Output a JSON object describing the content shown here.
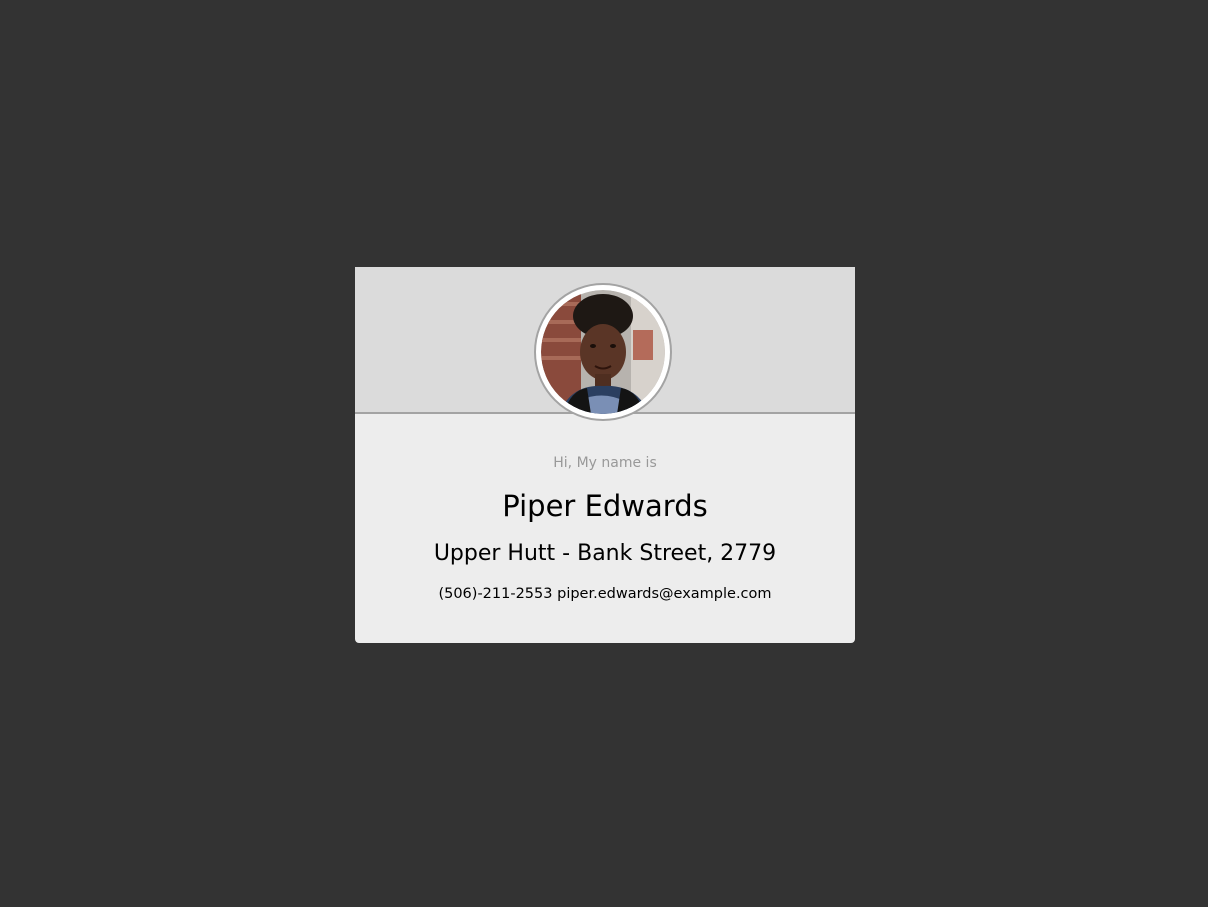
{
  "card": {
    "avatar_alt": "Piper Edwards photo",
    "greeting": "Hi, My name is",
    "name": "Piper Edwards",
    "address": "Upper Hutt - Bank Street, 2779",
    "phone": "(506)-211-2553",
    "email": "piper.edwards@example.com"
  },
  "colors": {
    "page_background": "#333333",
    "card_background": "#ededed",
    "header_background": "#dbdbdb",
    "divider": "#a3a3a3",
    "greeting_text": "#999999"
  },
  "icons": [
    "avatar-photo"
  ]
}
